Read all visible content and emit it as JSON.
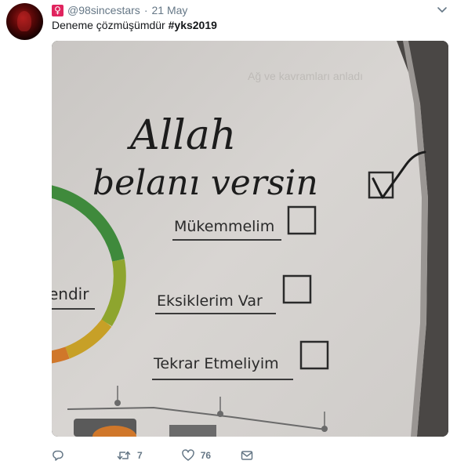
{
  "tweet": {
    "handle": "@98sincestars",
    "separator": "·",
    "date": "21 May",
    "badge_icon": "venus-icon",
    "text_prefix": "Deneme çözmüşümdür ",
    "hashtag": "#yks2019"
  },
  "photo": {
    "handwriting_line1": "Allah",
    "handwriting_line2": "belanı versin",
    "options": [
      {
        "label": "Mükemmelim"
      },
      {
        "label": "Eksiklerim Var"
      },
      {
        "label": "Tekrar Etmeliyim"
      }
    ],
    "partial_word": "endir",
    "top_faint_text": "Ağ ve kavramları anladı"
  },
  "actions": {
    "reply_icon": "reply-icon",
    "retweet_icon": "retweet-icon",
    "retweet_count": "7",
    "like_icon": "heart-icon",
    "like_count": "76",
    "message_icon": "envelope-icon"
  },
  "colors": {
    "secondary_text": "#657786",
    "primary_text": "#14171a",
    "badge": "#e0245e"
  }
}
